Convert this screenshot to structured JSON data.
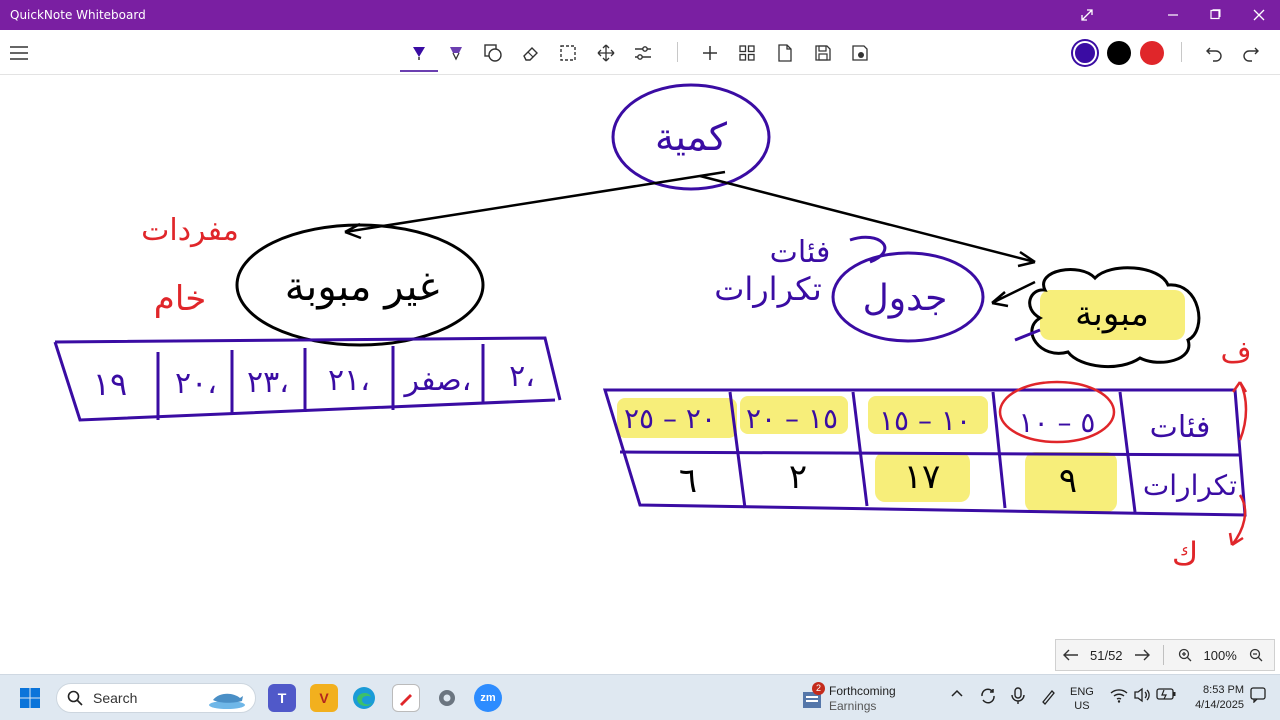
{
  "window": {
    "title": "QuickNote Whiteboard"
  },
  "colors": {
    "titlebar": "#7a1fa2",
    "ink_purple": "#3a0ca3",
    "ink_black": "#000000",
    "ink_red": "#e0262a",
    "highlight": "#f7ee7a"
  },
  "toolbar": {
    "icons": [
      "menu-icon",
      "pen-icon",
      "highlighter-icon",
      "shapes-icon",
      "eraser-icon",
      "lasso-select-icon",
      "pan-icon",
      "settings-sliders-icon",
      "add-icon",
      "grid-icon",
      "page-icon",
      "save-icon",
      "export-icon",
      "undo-icon",
      "redo-icon"
    ],
    "swatches": [
      "#3a0ca3",
      "#000000",
      "#e0262a"
    ]
  },
  "whiteboard": {
    "root_node": "كمية",
    "left_node": "غير مبوبة",
    "left_note_line1": "مفردات",
    "left_note_line2": "خام",
    "left_row": [
      "١٩",
      "٢٠،",
      "٢٣،",
      "٢١،",
      "صفر،",
      "٢،"
    ],
    "right_node": "مبوبة",
    "right_node2": "جدول",
    "right_note_line1": "فئات",
    "right_note_line2": "تكرارات",
    "table_header": [
      "فئات",
      "٥ – ١٠",
      "١٠ – ١٥",
      "١٥ – ٢٠",
      "٢٠ – ٢٥"
    ],
    "table_values": [
      "تكرارات",
      "٩",
      "١٧",
      "٢",
      "٦"
    ],
    "side_label_top": "ف",
    "side_label_bottom": "ك"
  },
  "pagenav": {
    "page": "51/52",
    "zoom": "100%"
  },
  "taskbar": {
    "search_placeholder": "Search",
    "news_badge": "2",
    "news_title": "Forthcoming",
    "news_sub": "Earnings",
    "lang_top": "ENG",
    "lang_bottom": "US",
    "time": "8:53 PM",
    "date": "4/14/2025"
  }
}
